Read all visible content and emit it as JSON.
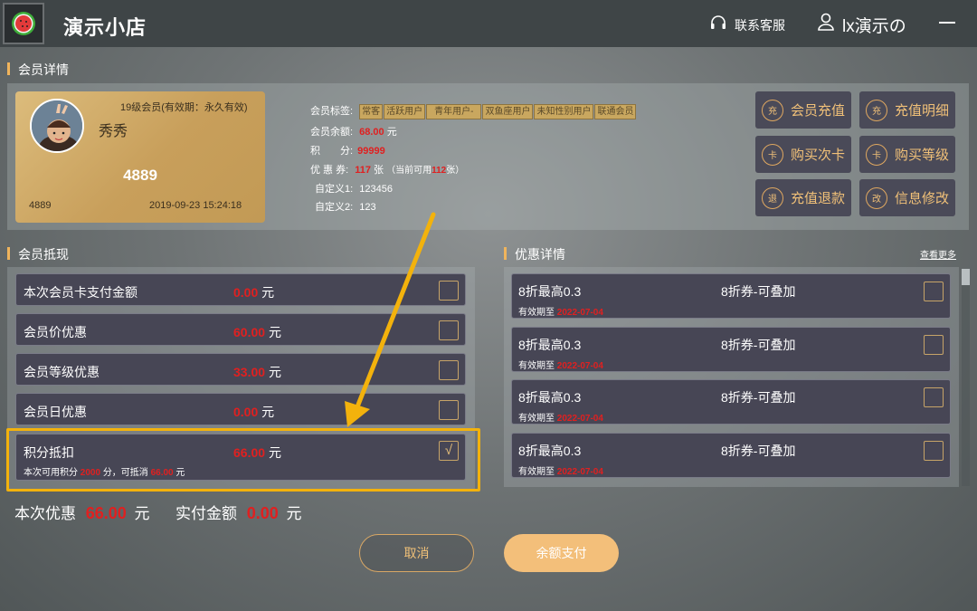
{
  "app": {
    "title": "演示小店",
    "support": "联系客服",
    "user": "lx演示の"
  },
  "sections": {
    "member_detail": "会员详情",
    "member_offset": "会员抵现",
    "discount_detail": "优惠详情",
    "see_more": "查看更多"
  },
  "card": {
    "level": "19级会员(有效期：永久有效)",
    "nickname": "秀秀",
    "card_no_big": "4889",
    "card_no": "4889",
    "date": "2019-09-23 15:24:18"
  },
  "member_info": {
    "tags_label": "会员标签:",
    "tags": [
      "常客",
      "活跃用户",
      "青年用户-",
      "双鱼座用户",
      "未知性别用户",
      "联通会员"
    ],
    "balance_label": "会员余额:",
    "balance": "68.00",
    "balance_unit": "元",
    "points_label": "积　　分:",
    "points": "99999",
    "coupons_label": "优 惠 券:",
    "coupons": "117",
    "coupons_unit": "张",
    "coupons_avail_prefix": "（当前可用",
    "coupons_avail": "112",
    "coupons_avail_suffix": "张）",
    "custom1_label": "自定义1:",
    "custom1": "123456",
    "custom2_label": "自定义2:",
    "custom2": "123"
  },
  "actions": [
    {
      "icon": "充",
      "label": "会员充值"
    },
    {
      "icon": "充",
      "label": "充值明细"
    },
    {
      "icon": "卡",
      "label": "购买次卡"
    },
    {
      "icon": "卡",
      "label": "购买等级"
    },
    {
      "icon": "退",
      "label": "充值退款"
    },
    {
      "icon": "改",
      "label": "信息修改"
    }
  ],
  "offsets": [
    {
      "name": "本次会员卡支付金额",
      "amount": "0.00",
      "unit": "元",
      "checked": false
    },
    {
      "name": "会员价优惠",
      "amount": "60.00",
      "unit": "元",
      "checked": false
    },
    {
      "name": "会员等级优惠",
      "amount": "33.00",
      "unit": "元",
      "checked": false
    },
    {
      "name": "会员日优惠",
      "amount": "0.00",
      "unit": "元",
      "checked": false
    },
    {
      "name": "积分抵扣",
      "amount": "66.00",
      "unit": "元",
      "checked": true
    }
  ],
  "points_note": {
    "p1": "本次可用积分",
    "points": "2000",
    "p2": "分，可抵消",
    "amount": "66.00",
    "p3": "元"
  },
  "check_mark": "√",
  "coupons": [
    {
      "title": "8折最高0.3",
      "type": "8折券-可叠加",
      "expire_label": "有效期至",
      "expire": "2022-07-04"
    },
    {
      "title": "8折最高0.3",
      "type": "8折券-可叠加",
      "expire_label": "有效期至",
      "expire": "2022-07-04"
    },
    {
      "title": "8折最高0.3",
      "type": "8折券-可叠加",
      "expire_label": "有效期至",
      "expire": "2022-07-04"
    },
    {
      "title": "8折最高0.3",
      "type": "8折券-可叠加",
      "expire_label": "有效期至",
      "expire": "2022-07-04"
    }
  ],
  "totals": {
    "discount_label": "本次优惠",
    "discount": "66.00",
    "pay_label": "实付金额",
    "pay": "0.00",
    "unit": "元"
  },
  "buttons": {
    "cancel": "取消",
    "pay": "余额支付"
  },
  "colors": {
    "accent": "#f0c078",
    "highlight": "#f3b20c",
    "value": "#e02020"
  }
}
